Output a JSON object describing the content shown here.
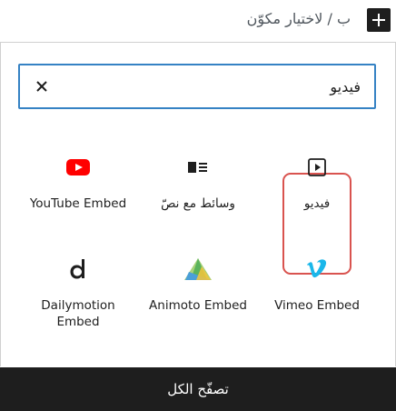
{
  "topbar": {
    "hint_text": "ب / لاختيار مكوّن",
    "plus_icon": "plus-icon"
  },
  "search": {
    "value": "فيديو",
    "clear_icon": "close-icon"
  },
  "blocks": [
    {
      "label": "فيديو",
      "icon": "video-icon"
    },
    {
      "label": "وسائط مع نصّ",
      "icon": "media-text-icon"
    },
    {
      "label": "YouTube Embed",
      "icon": "youtube-icon"
    },
    {
      "label": "Vimeo Embed",
      "icon": "vimeo-icon"
    },
    {
      "label": "Animoto Embed",
      "icon": "animoto-icon"
    },
    {
      "label": "Dailymotion Embed",
      "icon": "dailymotion-icon"
    }
  ],
  "footer": {
    "browse_all_label": "تصفّح الكل"
  },
  "colors": {
    "accent": "#3582c4",
    "highlight": "#d9534f",
    "youtube": "#ff0000",
    "vimeo": "#1ab7ea"
  }
}
